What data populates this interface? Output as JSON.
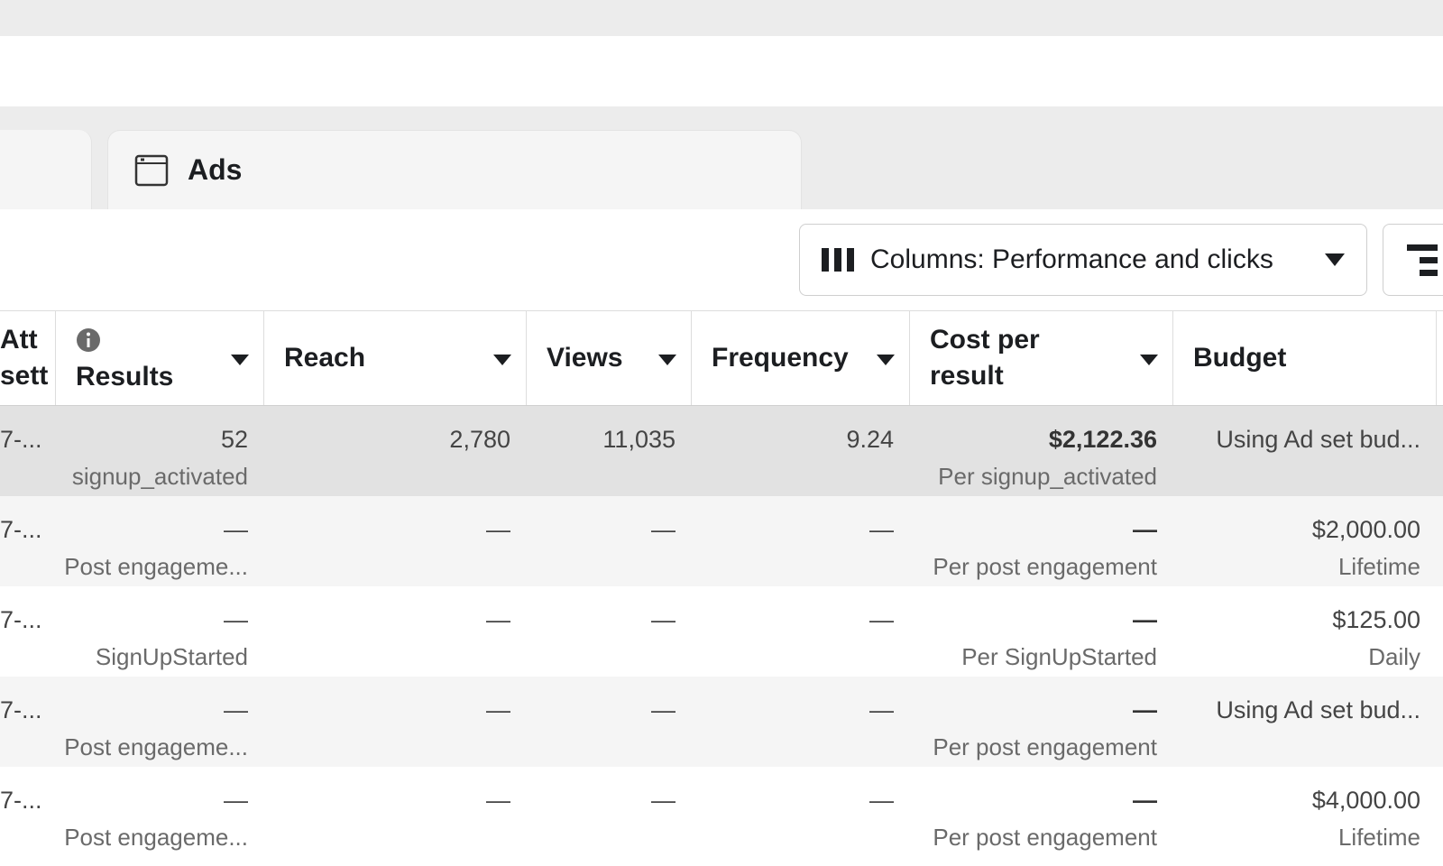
{
  "tabs": {
    "ads_label": "Ads"
  },
  "toolbar": {
    "columns_label": "Columns: Performance and clicks"
  },
  "headers": {
    "attr": [
      "Att",
      "sett"
    ],
    "results": "Results",
    "reach": "Reach",
    "views": "Views",
    "frequency": "Frequency",
    "cost_per_result": [
      "Cost per",
      "result"
    ],
    "budget": "Budget"
  },
  "rows": [
    {
      "attr": "7-...",
      "results": "52",
      "results_sub": "signup_activated",
      "reach": "2,780",
      "views": "11,035",
      "frequency": "9.24",
      "cost": "$2,122.36",
      "cost_sub": "Per signup_activated",
      "budget": "Using Ad set bud...",
      "budget_sub": ""
    },
    {
      "attr": "7-...",
      "results": "—",
      "results_sub": "Post engageme...",
      "reach": "—",
      "views": "—",
      "frequency": "—",
      "cost": "—",
      "cost_sub": "Per post engagement",
      "budget": "$2,000.00",
      "budget_sub": "Lifetime"
    },
    {
      "attr": "7-...",
      "results": "—",
      "results_sub": "SignUpStarted",
      "reach": "—",
      "views": "—",
      "frequency": "—",
      "cost": "—",
      "cost_sub": "Per SignUpStarted",
      "budget": "$125.00",
      "budget_sub": "Daily"
    },
    {
      "attr": "7-...",
      "results": "—",
      "results_sub": "Post engageme...",
      "reach": "—",
      "views": "—",
      "frequency": "—",
      "cost": "—",
      "cost_sub": "Per post engagement",
      "budget": "Using Ad set bud...",
      "budget_sub": ""
    },
    {
      "attr": "7-...",
      "results": "—",
      "results_sub": "Post engageme...",
      "reach": "—",
      "views": "—",
      "frequency": "—",
      "cost": "—",
      "cost_sub": "Per post engagement",
      "budget": "$4,000.00",
      "budget_sub": "Lifetime"
    }
  ],
  "icons": {
    "tab": "ad-window-icon",
    "columns": "columns-icon",
    "breakdown": "breakdown-icon",
    "info": "info-icon",
    "sort": "caret-down-icon"
  },
  "colors": {
    "selected_row": "#e2e2e2",
    "alt_row": "#f5f5f5",
    "tab_bg": "#f5f5f5",
    "border": "#dddddd"
  }
}
